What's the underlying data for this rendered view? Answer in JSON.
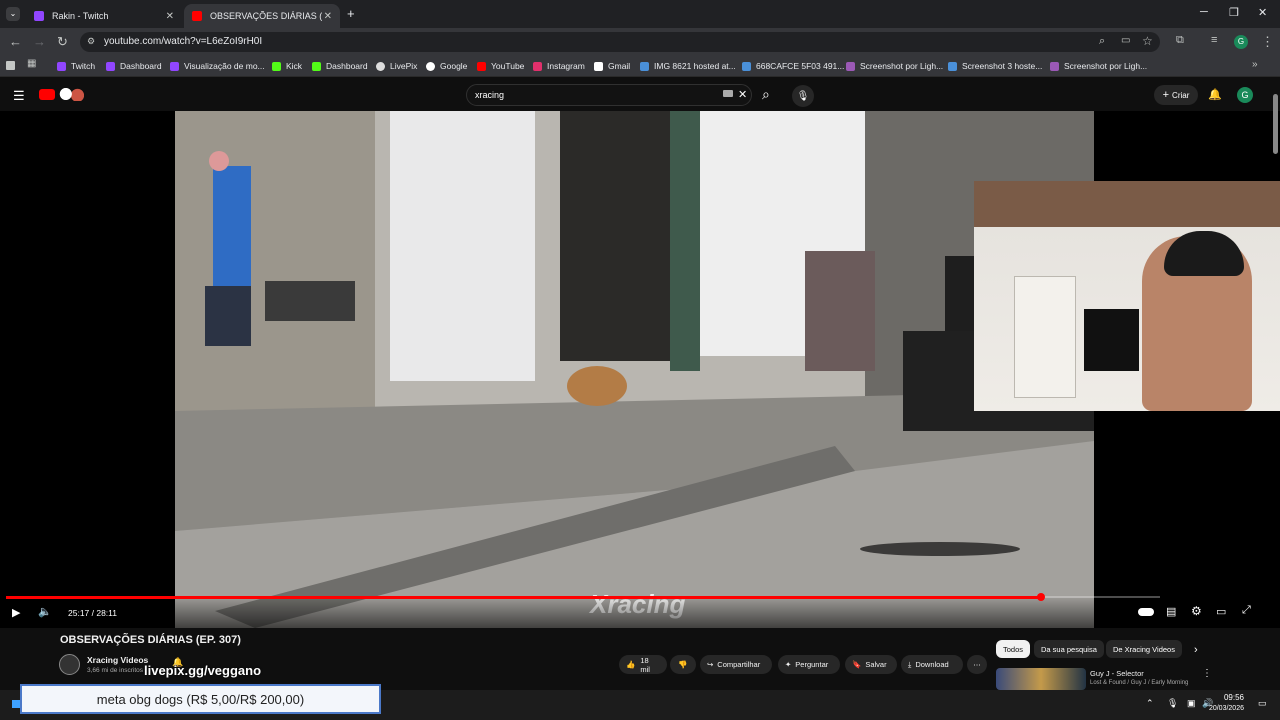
{
  "browser": {
    "tabs": [
      {
        "title": "Rakin - Twitch",
        "active": false,
        "favicon_color": "#9146ff"
      },
      {
        "title": "OBSERVAÇÕES DIÁRIAS (EP. 30",
        "active": true,
        "favicon_color": "#ff0000"
      }
    ],
    "url": "youtube.com/watch?v=L6eZoI9rH0I",
    "bookmarks": [
      {
        "label": "Twitch",
        "icon_color": "#9146ff"
      },
      {
        "label": "Dashboard",
        "icon_color": "#9146ff"
      },
      {
        "label": "Visualização de mo...",
        "icon_color": "#9146ff"
      },
      {
        "label": "Kick",
        "icon_color": "#53fc18"
      },
      {
        "label": "Dashboard",
        "icon_color": "#53fc18"
      },
      {
        "label": "LivePix",
        "icon_color": "#ffffff"
      },
      {
        "label": "Google",
        "icon_color": "#ffffff"
      },
      {
        "label": "YouTube",
        "icon_color": "#ff0000"
      },
      {
        "label": "Instagram",
        "icon_color": "#e1306c"
      },
      {
        "label": "Gmail",
        "icon_color": "#ffffff"
      },
      {
        "label": "IMG 8621 hosted at...",
        "icon_color": "#4a90d9"
      },
      {
        "label": "668CAFCE 5F03 491...",
        "icon_color": "#4a90d9"
      },
      {
        "label": "Screenshot por Ligh...",
        "icon_color": "#9b59b6"
      },
      {
        "label": "Screenshot 3 hoste...",
        "icon_color": "#4a90d9"
      },
      {
        "label": "Screenshot por Ligh...",
        "icon_color": "#9b59b6"
      }
    ]
  },
  "youtube": {
    "search_query": "xracing",
    "create_label": "Criar",
    "avatar_letter": "G",
    "player": {
      "time": "25:17 / 28:11",
      "progress_fraction": 0.897,
      "watermark": "Xracing"
    },
    "video": {
      "title": "OBSERVAÇÕES DIÁRIAS (EP. 307)",
      "channel": "Xracing Videos",
      "subscribers": "3,66 mi de inscritos",
      "likes": "18 mil",
      "share": "Compartilhar",
      "ask": "Perguntar",
      "save": "Salvar",
      "download": "Download"
    },
    "chips": [
      "Todos",
      "Da sua pesquisa",
      "De Xracing Videos"
    ],
    "recommended": {
      "title": "Guy J - Selector",
      "subtitle": "Lost & Found / Guy J / Early Morning"
    }
  },
  "overlay": {
    "livepix": "livepix.gg/veggano",
    "goal": "meta obg dogs (R$ 5,00/R$ 200,00)"
  },
  "taskbar": {
    "time": "09:56",
    "date": "20/03/2026"
  }
}
